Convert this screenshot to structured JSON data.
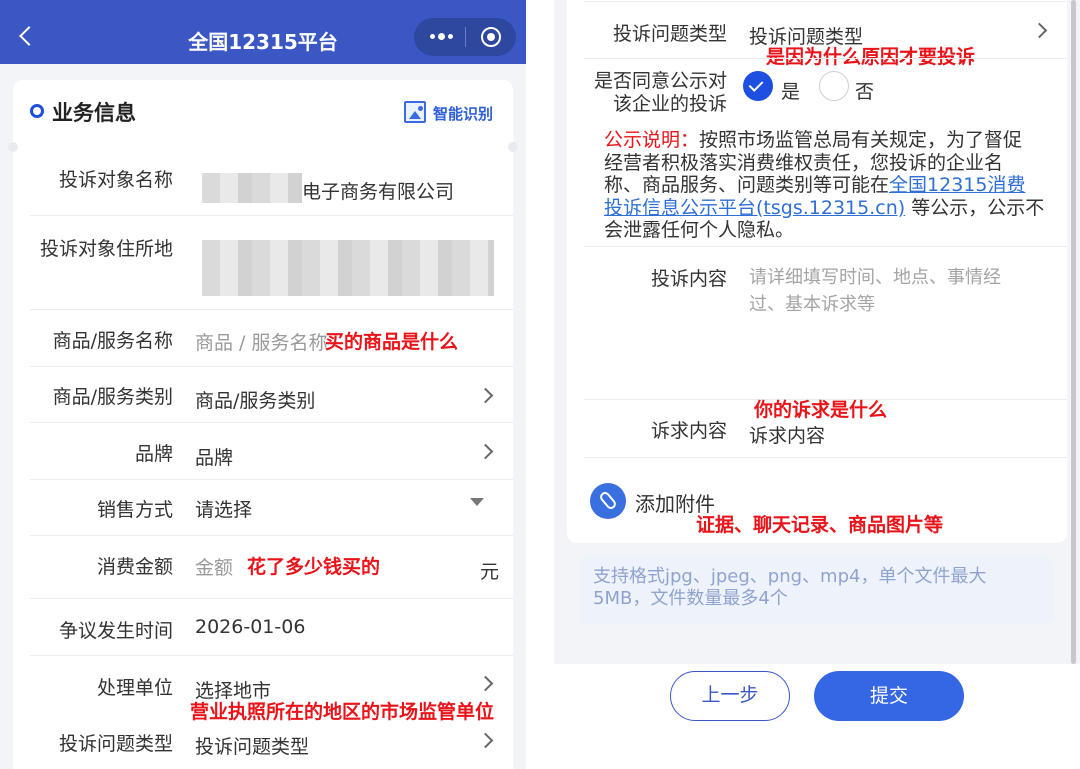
{
  "left": {
    "nav": {
      "title": "全国12315平台"
    },
    "section": {
      "title": "业务信息",
      "ocr_label": "智能识别"
    },
    "fields": {
      "target_name": {
        "label": "投诉对象名称",
        "value": "电子商务有限公司"
      },
      "target_address": {
        "label": "投诉对象住所地"
      },
      "goods_name": {
        "label": "商品/服务名称",
        "placeholder": "商品 / 服务名称",
        "note": "买的商品是什么"
      },
      "goods_type": {
        "label": "商品/服务类别",
        "value": "商品/服务类别"
      },
      "brand": {
        "label": "品牌",
        "value": "品牌"
      },
      "sale_method": {
        "label": "销售方式",
        "value": "请选择"
      },
      "amount": {
        "label": "消费金额",
        "placeholder": "金额",
        "note": "花了多少钱买的",
        "unit": "元"
      },
      "dispute_time": {
        "label": "争议发生时间",
        "value": "2026-01-06"
      },
      "handler": {
        "label": "处理单位",
        "value": "选择地市",
        "note": "营业执照所在的地区的市场监管单位"
      },
      "issue_type": {
        "label": "投诉问题类型",
        "value": "投诉问题类型"
      }
    }
  },
  "right": {
    "issue_type": {
      "label": "投诉问题类型",
      "value": "投诉问题类型",
      "note": "是因为什么原因才要投诉"
    },
    "publicity": {
      "label_line1": "是否同意公示对",
      "label_line2": "该企业的投诉",
      "yes": "是",
      "no": "否"
    },
    "notice": {
      "title": "公示说明：",
      "line1": "按照市场监管总局有关规定，为了督促",
      "line2": "经营者积极落实消费维权责任，您投诉的企业名",
      "line3a": "称、商品服务、问题类别等可能在",
      "link_part1": "全国12315消费",
      "link_part2": "投诉信息公示平台(tsgs.12315.cn)",
      "line4b": "等公示，公示不",
      "line5": "会泄露任何个人隐私。"
    },
    "content": {
      "label": "投诉内容",
      "placeholder_line1": "请详细填写时间、地点、事情经",
      "placeholder_line2": "过、基本诉求等"
    },
    "demand": {
      "label": "诉求内容",
      "value": "诉求内容",
      "note": "你的诉求是什么"
    },
    "attachment": {
      "label": "添加附件",
      "note": "证据、聊天记录、商品图片等"
    },
    "format_hint": {
      "line1": "支持格式jpg、jpeg、png、mp4，单个文件最大",
      "line2": "5MB，文件数量最多4个"
    },
    "buttons": {
      "prev": "上一步",
      "submit": "提交"
    }
  },
  "colors": {
    "nav_bg": "#3a57c4",
    "accent": "#1d4fe0",
    "annotation": "#e8141a",
    "link": "#2f6fd4"
  }
}
